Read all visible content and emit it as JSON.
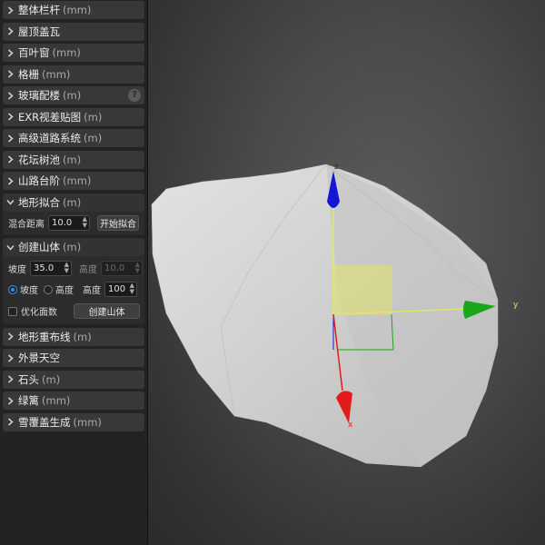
{
  "sidebar": {
    "sections_top": [
      {
        "label": "整体栏杆",
        "unit": "(mm)"
      },
      {
        "label": "屋顶盖瓦",
        "unit": ""
      },
      {
        "label": "百叶窗",
        "unit": "(mm)"
      },
      {
        "label": "格栅",
        "unit": "(mm)"
      },
      {
        "label": "玻璃配楼",
        "unit": "(m)",
        "help": "?"
      },
      {
        "label": "EXR视差贴图",
        "unit": "(m)"
      },
      {
        "label": "高级道路系统",
        "unit": "(m)"
      },
      {
        "label": "花坛树池",
        "unit": "(m)"
      },
      {
        "label": "山路台阶",
        "unit": "(mm)"
      }
    ],
    "terrain_fit": {
      "label": "地形拟合",
      "unit": "(m)",
      "blend_label": "混合距离",
      "blend_value": "10.0",
      "start_button": "开始拟合"
    },
    "create_mountain": {
      "label": "创建山体",
      "unit": "(m)",
      "slope_label": "坡度",
      "slope_value": "35.0",
      "height_label_disabled": "高度",
      "height_value_disabled": "10.0",
      "radio_slope": "坡度",
      "radio_height": "高度",
      "height_label": "高度",
      "height_value": "100",
      "optimize_label": "优化面数",
      "create_button": "创建山体"
    },
    "sections_bottom": [
      {
        "label": "地形重布线",
        "unit": "(m)"
      },
      {
        "label": "外景天空",
        "unit": ""
      },
      {
        "label": "石头",
        "unit": "(m)"
      },
      {
        "label": "绿篱",
        "unit": "(mm)"
      },
      {
        "label": "雪覆盖生成",
        "unit": "(mm)"
      }
    ]
  },
  "viewport": {
    "axis_x_label": "x",
    "axis_y_label": "y",
    "axis_z_label": "z",
    "colors": {
      "x": "#e31b1b",
      "y": "#1aa61a",
      "z": "#1515d6",
      "plane": "#e4e46a"
    }
  }
}
